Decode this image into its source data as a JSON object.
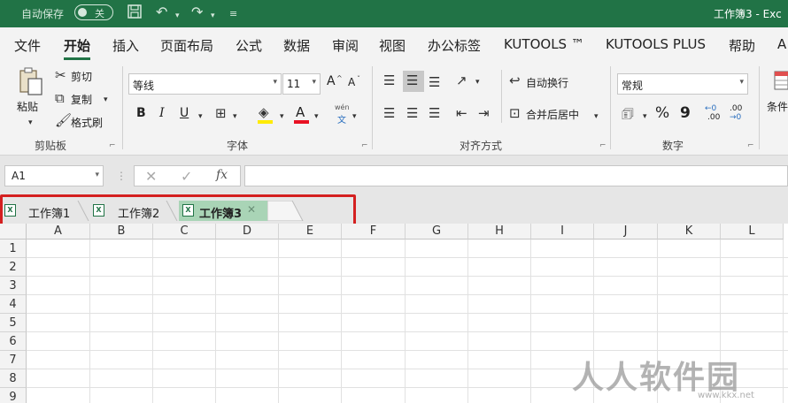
{
  "titlebar": {
    "autosave_label": "自动保存",
    "autosave_state": "关",
    "title": "工作簿3 - Exc"
  },
  "menu": {
    "items": [
      "文件",
      "开始",
      "插入",
      "页面布局",
      "公式",
      "数据",
      "审阅",
      "视图",
      "办公标签",
      "KUTOOLS ™",
      "KUTOOLS PLUS",
      "帮助",
      "A"
    ],
    "active": "开始"
  },
  "ribbon": {
    "clipboard": {
      "paste": "粘贴",
      "cut": "剪切",
      "copy": "复制",
      "format_painter": "格式刷",
      "group_label": "剪贴板"
    },
    "font": {
      "font_name": "等线",
      "font_size": "11",
      "grow": "A",
      "shrink": "A",
      "bold": "B",
      "italic": "I",
      "underline": "U",
      "phonetic_top": "wén",
      "phonetic_bottom": "文",
      "group_label": "字体"
    },
    "alignment": {
      "wrap_text": "自动换行",
      "merge_center": "合并后居中",
      "group_label": "对齐方式"
    },
    "number": {
      "format": "常规",
      "percent": "%",
      "comma": "9",
      "inc_decimal_top": "←0",
      "inc_decimal_bottom": ".00",
      "dec_decimal_top": ".00",
      "dec_decimal_bottom": "→0",
      "group_label": "数字"
    },
    "styles": {
      "conditional": "条件"
    }
  },
  "formula_bar": {
    "name_box": "A1",
    "fx": "fx",
    "value": ""
  },
  "tabs": [
    {
      "label": "工作簿1",
      "active": false
    },
    {
      "label": "工作簿2",
      "active": false
    },
    {
      "label": "工作簿3",
      "active": true
    }
  ],
  "grid": {
    "columns": [
      "A",
      "B",
      "C",
      "D",
      "E",
      "F",
      "G",
      "H",
      "I",
      "J",
      "K",
      "L"
    ],
    "rows": [
      "1",
      "2",
      "3",
      "4",
      "5",
      "6",
      "7",
      "8",
      "9"
    ]
  },
  "watermark": {
    "text": "人人软件园",
    "url": "www.kkx.net"
  },
  "colors": {
    "titlebar": "#217346",
    "active_tab": "#a9d4b6",
    "highlight_box": "#d42020"
  }
}
